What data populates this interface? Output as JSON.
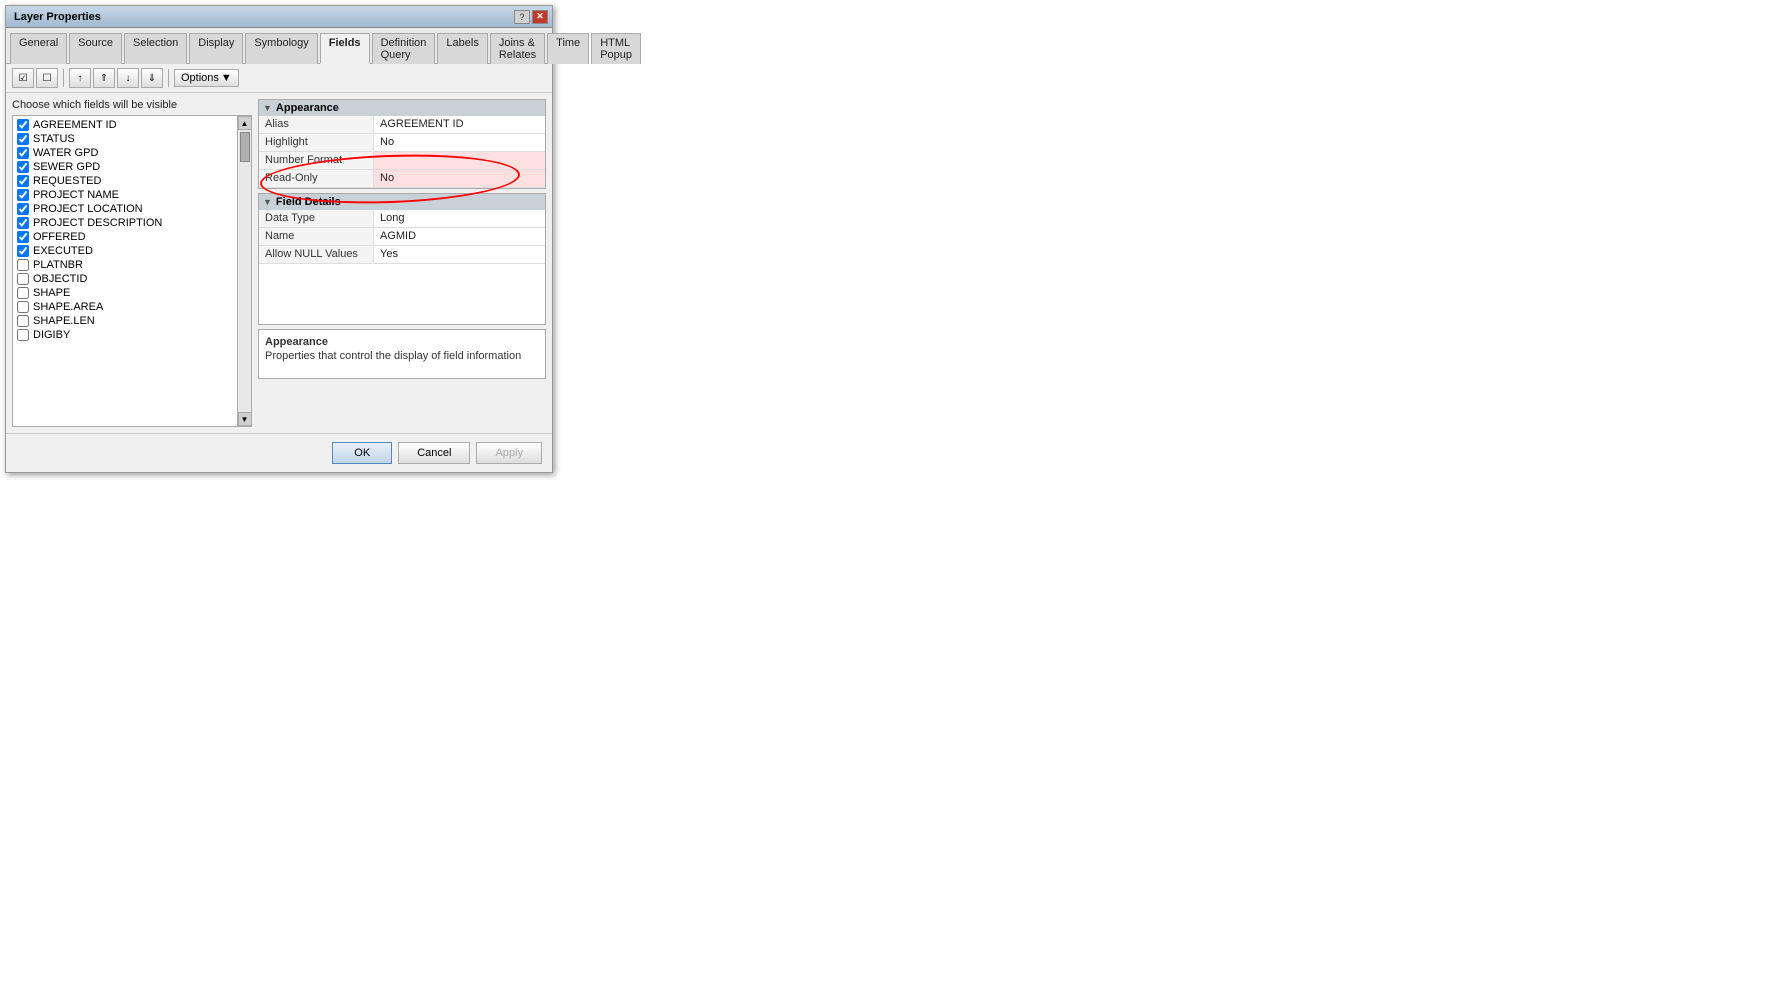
{
  "window": {
    "title": "Layer Properties"
  },
  "tabs": [
    {
      "label": "General",
      "active": false
    },
    {
      "label": "Source",
      "active": false
    },
    {
      "label": "Selection",
      "active": false
    },
    {
      "label": "Display",
      "active": false
    },
    {
      "label": "Symbology",
      "active": false
    },
    {
      "label": "Fields",
      "active": true
    },
    {
      "label": "Definition Query",
      "active": false
    },
    {
      "label": "Labels",
      "active": false
    },
    {
      "label": "Joins & Relates",
      "active": false
    },
    {
      "label": "Time",
      "active": false
    },
    {
      "label": "HTML Popup",
      "active": false
    }
  ],
  "toolbar": {
    "options_label": "Options",
    "chevron": "▼"
  },
  "field_list": {
    "label": "Choose which fields will be visible",
    "fields": [
      {
        "name": "AGREEMENT ID",
        "checked": true
      },
      {
        "name": "STATUS",
        "checked": true
      },
      {
        "name": "WATER GPD",
        "checked": true
      },
      {
        "name": "SEWER GPD",
        "checked": true
      },
      {
        "name": "REQUESTED",
        "checked": true
      },
      {
        "name": "PROJECT NAME",
        "checked": true
      },
      {
        "name": "PROJECT LOCATION",
        "checked": true
      },
      {
        "name": "PROJECT DESCRIPTION",
        "checked": true
      },
      {
        "name": "OFFERED",
        "checked": true
      },
      {
        "name": "EXECUTED",
        "checked": true
      },
      {
        "name": "PLATNBR",
        "checked": false
      },
      {
        "name": "OBJECTID",
        "checked": false
      },
      {
        "name": "SHAPE",
        "checked": false
      },
      {
        "name": "SHAPE.AREA",
        "checked": false
      },
      {
        "name": "SHAPE.LEN",
        "checked": false
      },
      {
        "name": "DIGIBY",
        "checked": false
      }
    ]
  },
  "appearance_section": {
    "header": "Appearance",
    "rows": [
      {
        "key": "Alias",
        "value": "AGREEMENT ID"
      },
      {
        "key": "Highlight",
        "value": "No"
      },
      {
        "key": "Number Format",
        "value": "",
        "highlighted": true
      },
      {
        "key": "Read-Only",
        "value": "No",
        "highlighted": true
      }
    ]
  },
  "field_details_section": {
    "header": "Field Details",
    "rows": [
      {
        "key": "Data Type",
        "value": "Long"
      },
      {
        "key": "Name",
        "value": "AGMID"
      },
      {
        "key": "Allow NULL Values",
        "value": "Yes"
      }
    ]
  },
  "description": {
    "title": "Appearance",
    "text": "Properties that control the display of field information"
  },
  "buttons": {
    "ok": "OK",
    "cancel": "Cancel",
    "apply": "Apply"
  }
}
